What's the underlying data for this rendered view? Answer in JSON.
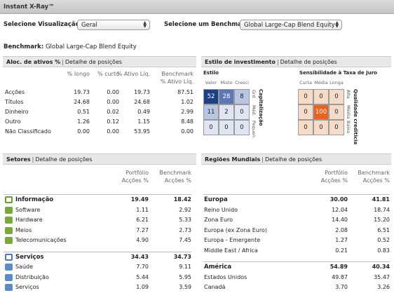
{
  "window": {
    "title": "Instant X-Ray™"
  },
  "controls": {
    "visualizacao_label": "Selecione Visualização",
    "visualizacao_value": "Geral",
    "benchmark_label": "Selecione um Benchmark",
    "benchmark_value": "Global Large-Cap Blend Equity"
  },
  "benchmark_line": {
    "label": "Benchmark:",
    "value": "Global Large-Cap Blend Equity"
  },
  "alloc": {
    "title": "Aloc. de ativos %",
    "link": "Detalhe de posições",
    "headers": [
      "% longo",
      "% curto",
      "% Ativo Líq.",
      "Benchmark",
      "% Ativo Líq."
    ],
    "rows": [
      {
        "label": "Acções",
        "vals": [
          "19.73",
          "0.00",
          "19.73",
          "87.51"
        ]
      },
      {
        "label": "Títulos",
        "vals": [
          "24.68",
          "0.00",
          "24.68",
          "1.02"
        ]
      },
      {
        "label": "Dinheiro",
        "vals": [
          "0.51",
          "0.02",
          "0.49",
          "2.99"
        ]
      },
      {
        "label": "Outro",
        "vals": [
          "1.26",
          "0.12",
          "1.15",
          "8.48"
        ]
      },
      {
        "label": "Não Classificado",
        "vals": [
          "0.00",
          "0.00",
          "53.95",
          "0.00"
        ]
      }
    ]
  },
  "estilo": {
    "title": "Estilo de investimento",
    "link": "Detalhe de posições",
    "equity": {
      "title": "Estilo",
      "cols": [
        "Valor",
        "Misto",
        "Cresci"
      ],
      "rows_labels": [
        "Grd",
        "Méd.",
        "Pequen"
      ],
      "axis_label": "Capitalização",
      "values": [
        "52",
        "28",
        "8",
        "11",
        "2",
        "0",
        "0",
        "0",
        "0"
      ],
      "colors": [
        "#1f3f84",
        "#5c77b5",
        "#b8c6e4",
        "#b8c6e4",
        "#dfe5f2",
        "#dfe5f2",
        "#dfe5f2",
        "#dfe5f2",
        "#dfe5f2"
      ]
    },
    "fixed": {
      "title": "Sensibilidade à Taxa de Juro",
      "cols": [
        "Curta",
        "Média",
        "Longa"
      ],
      "rows_labels": [
        "Alta",
        "Média",
        "Baixa"
      ],
      "axis_label": "Qualidade crediticia",
      "values": [
        "0",
        "0",
        "0",
        "0",
        "100",
        "0",
        "0",
        "0",
        "0"
      ],
      "colors": [
        "#f6dcc8",
        "#f6dcc8",
        "#f6dcc8",
        "#f6dcc8",
        "#e8641e",
        "#f6dcc8",
        "#f6dcc8",
        "#f6dcc8",
        "#f6dcc8"
      ]
    }
  },
  "setores": {
    "title": "Setores",
    "link": "Detalhe de posições",
    "col1": [
      "Portfólio",
      "Acções %"
    ],
    "col2": [
      "Benchmark",
      "Acções %"
    ],
    "rows": [
      {
        "label": "Informação",
        "v1": "19.49",
        "v2": "18.42",
        "group": true,
        "icon": "info-sector-icon",
        "color": "#6a9a2a"
      },
      {
        "label": "Software",
        "v1": "1.11",
        "v2": "2.92",
        "group": false,
        "icon": "software-icon",
        "color": "#7aa83a"
      },
      {
        "label": "Hardware",
        "v1": "6.21",
        "v2": "5.33",
        "group": false,
        "icon": "hardware-icon",
        "color": "#7aa83a"
      },
      {
        "label": "Meios",
        "v1": "7.27",
        "v2": "2.73",
        "group": false,
        "icon": "media-icon",
        "color": "#7aa83a"
      },
      {
        "label": "Telecomunicações",
        "v1": "4.90",
        "v2": "7.45",
        "group": false,
        "icon": "telecom-icon",
        "color": "#7aa83a"
      },
      {
        "label": "Serviços",
        "v1": "34.43",
        "v2": "34.73",
        "group": true,
        "icon": "services-sector-icon",
        "color": "#4a7ab8"
      },
      {
        "label": "Saúde",
        "v1": "7.70",
        "v2": "9.11",
        "group": false,
        "icon": "health-icon",
        "color": "#5a8ac8"
      },
      {
        "label": "Distribuição",
        "v1": "5.44",
        "v2": "5.95",
        "group": false,
        "icon": "distribution-icon",
        "color": "#5a8ac8"
      },
      {
        "label": "Serviços",
        "v1": "1.09",
        "v2": "3.59",
        "group": false,
        "icon": "consumer-services-icon",
        "color": "#5a8ac8"
      }
    ]
  },
  "regioes": {
    "title": "Regiões Mundiais",
    "link": "Detalhe de posições",
    "col1": [
      "Portfólio",
      "Acções %"
    ],
    "col2": [
      "Benchmark",
      "Acções %"
    ],
    "rows": [
      {
        "label": "Europa",
        "v1": "30.00",
        "v2": "41.81",
        "group": true
      },
      {
        "label": "Reino Unido",
        "v1": "12.04",
        "v2": "18.74",
        "group": false
      },
      {
        "label": "Zona Euro",
        "v1": "14.40",
        "v2": "15.20",
        "group": false
      },
      {
        "label": "Europa (ex Zona Euro)",
        "v1": "2.08",
        "v2": "6.51",
        "group": false
      },
      {
        "label": "Europa - Emergente",
        "v1": "1.27",
        "v2": "0.52",
        "group": false
      },
      {
        "label": "Middle East / Africa",
        "v1": "0.21",
        "v2": "0.83",
        "group": false
      },
      {
        "label": "América",
        "v1": "54.89",
        "v2": "40.34",
        "group": true
      },
      {
        "label": "Estados Unidos",
        "v1": "49.87",
        "v2": "35.47",
        "group": false
      },
      {
        "label": "Canadá",
        "v1": "3.70",
        "v2": "3.26",
        "group": false
      }
    ]
  }
}
